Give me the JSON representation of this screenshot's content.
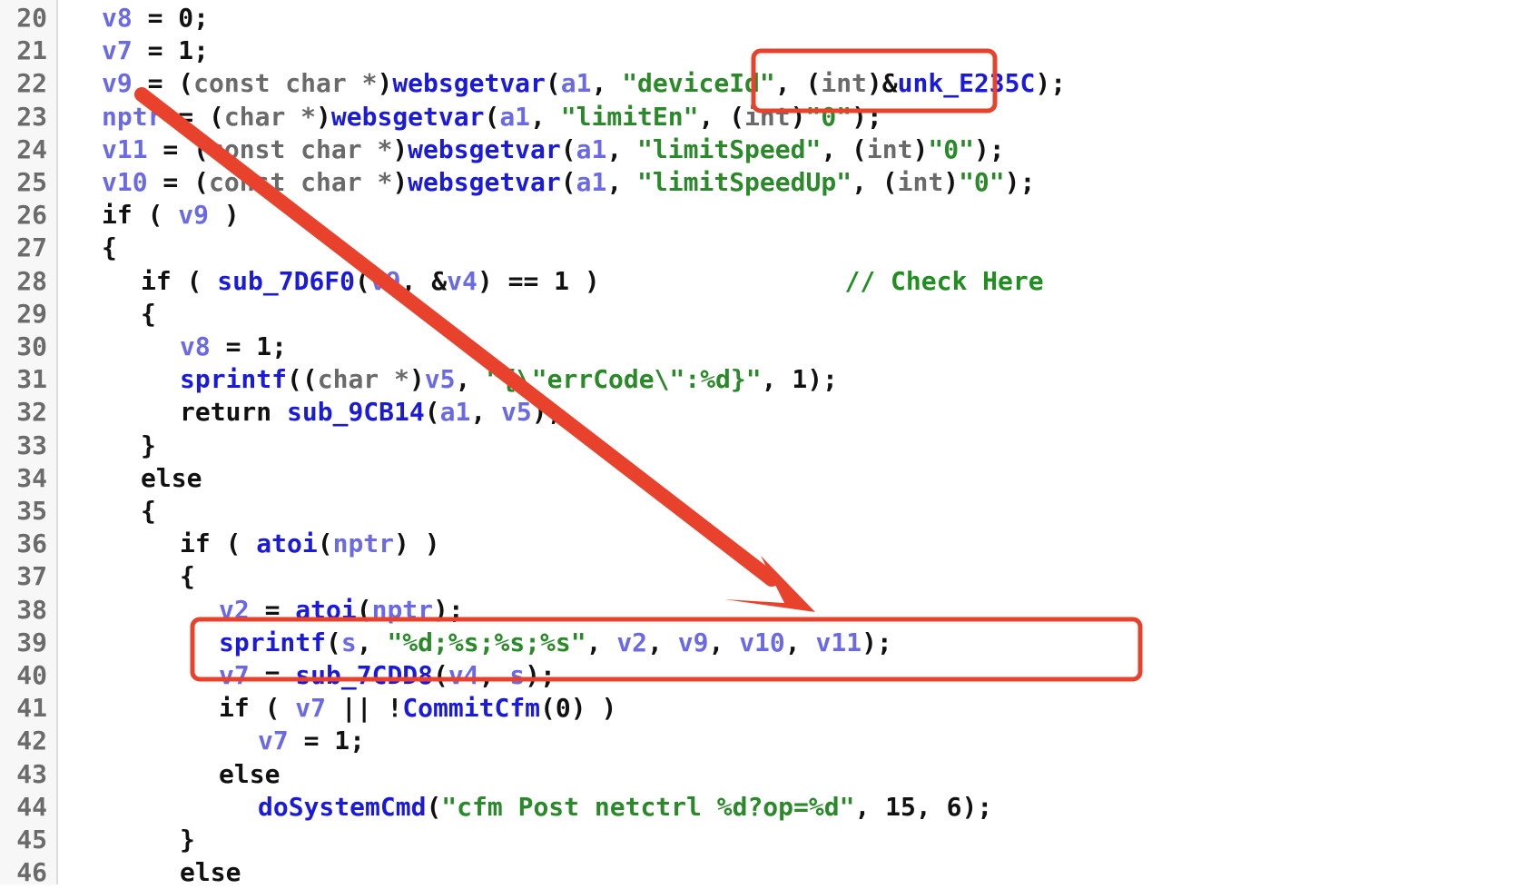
{
  "editor": {
    "lines": [
      {
        "num": "20",
        "indent": 0,
        "segs": [
          [
            "v",
            "v8"
          ],
          [
            "k",
            " = 0;"
          ]
        ]
      },
      {
        "num": "21",
        "indent": 0,
        "segs": [
          [
            "v",
            "v7"
          ],
          [
            "k",
            " = 1;"
          ]
        ]
      },
      {
        "num": "22",
        "indent": 0,
        "segs": [
          [
            "v",
            "v9"
          ],
          [
            "k",
            " = ("
          ],
          [
            "t",
            "const char *"
          ],
          [
            "k",
            ")"
          ],
          [
            "f",
            "websgetvar"
          ],
          [
            "k",
            "("
          ],
          [
            "v",
            "a1"
          ],
          [
            "k",
            ", "
          ],
          [
            "s",
            "\"deviceId\""
          ],
          [
            "k",
            ", ("
          ],
          [
            "t",
            "int"
          ],
          [
            "k",
            ")&"
          ],
          [
            "f",
            "unk_E235C"
          ],
          [
            "k",
            ");"
          ]
        ]
      },
      {
        "num": "23",
        "indent": 0,
        "segs": [
          [
            "v",
            "nptr"
          ],
          [
            "k",
            " = ("
          ],
          [
            "t",
            "char *"
          ],
          [
            "k",
            ")"
          ],
          [
            "f",
            "websgetvar"
          ],
          [
            "k",
            "("
          ],
          [
            "v",
            "a1"
          ],
          [
            "k",
            ", "
          ],
          [
            "s",
            "\"limitEn\""
          ],
          [
            "k",
            ", ("
          ],
          [
            "t",
            "int"
          ],
          [
            "k",
            ")"
          ],
          [
            "s",
            "\"0\""
          ],
          [
            "k",
            ");"
          ]
        ]
      },
      {
        "num": "24",
        "indent": 0,
        "segs": [
          [
            "v",
            "v11"
          ],
          [
            "k",
            " = ("
          ],
          [
            "t",
            "const char *"
          ],
          [
            "k",
            ")"
          ],
          [
            "f",
            "websgetvar"
          ],
          [
            "k",
            "("
          ],
          [
            "v",
            "a1"
          ],
          [
            "k",
            ", "
          ],
          [
            "s",
            "\"limitSpeed\""
          ],
          [
            "k",
            ", ("
          ],
          [
            "t",
            "int"
          ],
          [
            "k",
            ")"
          ],
          [
            "s",
            "\"0\""
          ],
          [
            "k",
            ");"
          ]
        ]
      },
      {
        "num": "25",
        "indent": 0,
        "segs": [
          [
            "v",
            "v10"
          ],
          [
            "k",
            " = ("
          ],
          [
            "t",
            "const char *"
          ],
          [
            "k",
            ")"
          ],
          [
            "f",
            "websgetvar"
          ],
          [
            "k",
            "("
          ],
          [
            "v",
            "a1"
          ],
          [
            "k",
            ", "
          ],
          [
            "s",
            "\"limitSpeedUp\""
          ],
          [
            "k",
            ", ("
          ],
          [
            "t",
            "int"
          ],
          [
            "k",
            ")"
          ],
          [
            "s",
            "\"0\""
          ],
          [
            "k",
            ");"
          ]
        ]
      },
      {
        "num": "26",
        "indent": 0,
        "segs": [
          [
            "k",
            "if ( "
          ],
          [
            "v",
            "v9"
          ],
          [
            "k",
            " )"
          ]
        ]
      },
      {
        "num": "27",
        "indent": 0,
        "segs": [
          [
            "k",
            "{"
          ]
        ]
      },
      {
        "num": "28",
        "indent": 1,
        "segs": [
          [
            "k",
            "if ( "
          ],
          [
            "f",
            "sub_7D6F0"
          ],
          [
            "k",
            "("
          ],
          [
            "v",
            "v9"
          ],
          [
            "k",
            ", &"
          ],
          [
            "v",
            "v4"
          ],
          [
            "k",
            ") == 1 )                "
          ],
          [
            "c",
            "// Check Here"
          ]
        ]
      },
      {
        "num": "29",
        "indent": 1,
        "segs": [
          [
            "k",
            "{"
          ]
        ]
      },
      {
        "num": "30",
        "indent": 2,
        "segs": [
          [
            "v",
            "v8"
          ],
          [
            "k",
            " = 1;"
          ]
        ]
      },
      {
        "num": "31",
        "indent": 2,
        "segs": [
          [
            "f",
            "sprintf"
          ],
          [
            "k",
            "(("
          ],
          [
            "t",
            "char *"
          ],
          [
            "k",
            ")"
          ],
          [
            "v",
            "v5"
          ],
          [
            "k",
            ", "
          ],
          [
            "s",
            "\"{\\\"errCode\\\":%d}\""
          ],
          [
            "k",
            ", 1);"
          ]
        ]
      },
      {
        "num": "32",
        "indent": 2,
        "segs": [
          [
            "k",
            "return "
          ],
          [
            "f",
            "sub_9CB14"
          ],
          [
            "k",
            "("
          ],
          [
            "v",
            "a1"
          ],
          [
            "k",
            ", "
          ],
          [
            "v",
            "v5"
          ],
          [
            "k",
            ");"
          ]
        ]
      },
      {
        "num": "33",
        "indent": 1,
        "segs": [
          [
            "k",
            "}"
          ]
        ]
      },
      {
        "num": "34",
        "indent": 1,
        "segs": [
          [
            "k",
            "else"
          ]
        ]
      },
      {
        "num": "35",
        "indent": 1,
        "segs": [
          [
            "k",
            "{"
          ]
        ]
      },
      {
        "num": "36",
        "indent": 2,
        "segs": [
          [
            "k",
            "if ( "
          ],
          [
            "f",
            "atoi"
          ],
          [
            "k",
            "("
          ],
          [
            "v",
            "nptr"
          ],
          [
            "k",
            ") )"
          ]
        ]
      },
      {
        "num": "37",
        "indent": 2,
        "segs": [
          [
            "k",
            "{"
          ]
        ]
      },
      {
        "num": "38",
        "indent": 3,
        "segs": [
          [
            "v",
            "v2"
          ],
          [
            "k",
            " = "
          ],
          [
            "f",
            "atoi"
          ],
          [
            "k",
            "("
          ],
          [
            "v",
            "nptr"
          ],
          [
            "k",
            ");"
          ]
        ]
      },
      {
        "num": "39",
        "indent": 3,
        "segs": [
          [
            "f",
            "sprintf"
          ],
          [
            "k",
            "("
          ],
          [
            "v",
            "s"
          ],
          [
            "k",
            ", "
          ],
          [
            "s",
            "\"%d;%s;%s;%s\""
          ],
          [
            "k",
            ", "
          ],
          [
            "v",
            "v2"
          ],
          [
            "k",
            ", "
          ],
          [
            "v",
            "v9"
          ],
          [
            "k",
            ", "
          ],
          [
            "v",
            "v10"
          ],
          [
            "k",
            ", "
          ],
          [
            "v",
            "v11"
          ],
          [
            "k",
            ");"
          ]
        ]
      },
      {
        "num": "40",
        "indent": 3,
        "segs": [
          [
            "v",
            "v7"
          ],
          [
            "k",
            " = "
          ],
          [
            "f",
            "sub_7CDD8"
          ],
          [
            "k",
            "("
          ],
          [
            "v",
            "v4"
          ],
          [
            "k",
            ", "
          ],
          [
            "v",
            "s"
          ],
          [
            "k",
            ");"
          ]
        ]
      },
      {
        "num": "41",
        "indent": 3,
        "segs": [
          [
            "k",
            "if ( "
          ],
          [
            "v",
            "v7"
          ],
          [
            "k",
            " || !"
          ],
          [
            "f",
            "CommitCfm"
          ],
          [
            "k",
            "(0) )"
          ]
        ]
      },
      {
        "num": "42",
        "indent": 4,
        "segs": [
          [
            "v",
            "v7"
          ],
          [
            "k",
            " = 1;"
          ]
        ]
      },
      {
        "num": "43",
        "indent": 3,
        "segs": [
          [
            "k",
            "else"
          ]
        ]
      },
      {
        "num": "44",
        "indent": 4,
        "segs": [
          [
            "f",
            "doSystemCmd"
          ],
          [
            "k",
            "("
          ],
          [
            "s",
            "\"cfm Post netctrl %d?op=%d\""
          ],
          [
            "k",
            ", 15, 6);"
          ]
        ]
      },
      {
        "num": "45",
        "indent": 2,
        "segs": [
          [
            "k",
            "}"
          ]
        ]
      },
      {
        "num": "46",
        "indent": 2,
        "segs": [
          [
            "k",
            "else"
          ]
        ]
      }
    ]
  },
  "annotations": {
    "color": "#e8412c",
    "highlight_source": "\"deviceId\",",
    "highlight_sink": "sprintf(s, \"%d;%s;%s;%s\", v2, v9, v10, v11);"
  }
}
